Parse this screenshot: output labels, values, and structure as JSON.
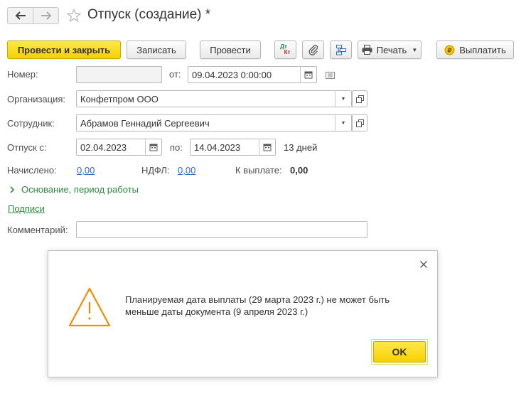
{
  "window": {
    "title": "Отпуск (создание) *"
  },
  "toolbar": {
    "post_and_close": "Провести и закрыть",
    "save": "Записать",
    "post": "Провести",
    "dt_kt_top": "Дт",
    "dt_kt_bottom": "Кт",
    "print": "Печать",
    "pay": "Выплатить"
  },
  "form": {
    "number_label": "Номер:",
    "number_value": "",
    "from_label": "от:",
    "doc_date": "09.04.2023  0:00:00",
    "organization_label": "Организация:",
    "organization_value": "Конфетпром ООО",
    "employee_label": "Сотрудник:",
    "employee_value": "Абрамов Геннадий Сергеевич",
    "vacation_from_label": "Отпуск с:",
    "vacation_from": "02.04.2023",
    "to_label": "по:",
    "vacation_to": "14.04.2023",
    "days": "13 дней",
    "accrued_label": "Начислено:",
    "accrued_value": "0,00",
    "ndfl_label": "НДФЛ:",
    "ndfl_value": "0,00",
    "to_pay_label": "К выплате:",
    "to_pay_value": "0,00",
    "basis_section": "Основание, период работы",
    "signatures_link": "Подписи",
    "comment_label": "Комментарий:",
    "comment_value": ""
  },
  "dialog": {
    "message_line1": "Планируемая дата выплаты (29 марта 2023 г.) не может быть",
    "message_line2": "меньше даты документа (9 апреля 2023 г.)",
    "ok_label": "OK"
  },
  "colors": {
    "accent_yellow": "#f6d000",
    "link_blue": "#3366cc",
    "section_green": "#2a8a3e",
    "warning_orange": "#f08c00"
  },
  "icons": [
    "back-arrow-icon",
    "forward-arrow-icon",
    "star-icon",
    "dt-kt-icon",
    "paperclip-icon",
    "structure-icon",
    "printer-icon",
    "dropdown-icon",
    "ruble-coin-icon",
    "calendar-icon",
    "open-icon",
    "list-icon",
    "chevron-right-icon",
    "close-icon",
    "warning-icon"
  ]
}
